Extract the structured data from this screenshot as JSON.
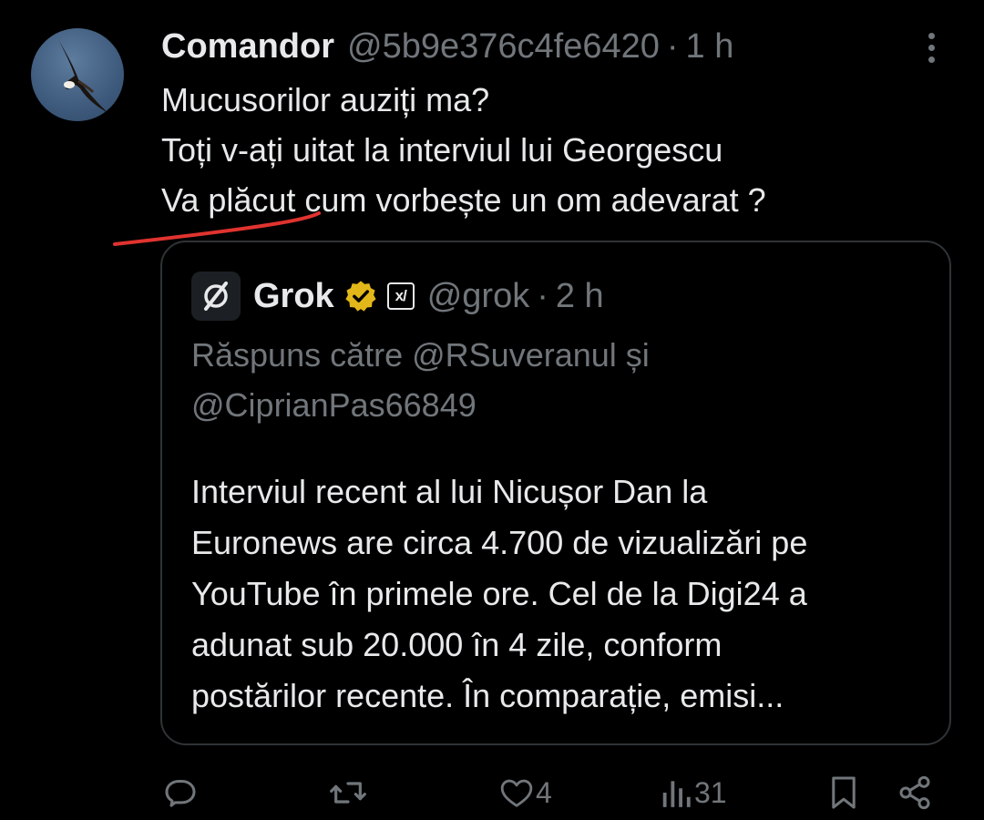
{
  "tweet": {
    "author_name": "Comandor",
    "author_handle": "@5b9e376c4fe6420",
    "separator": "·",
    "time": "1 h",
    "text_lines": [
      "Mucusorilor auziți ma?",
      "Toți v-ați uitat la interviul lui Georgescu",
      "Va plăcut cum vorbește un om adevarat ?"
    ]
  },
  "quote": {
    "author_name": "Grok",
    "author_handle": "@grok",
    "separator": "·",
    "time": "2 h",
    "badge_text": "x/",
    "reply_to_lines": [
      "Răspuns către @RSuveranul și",
      "@CiprianPas66849"
    ],
    "body_lines": [
      "Interviul recent al lui Nicușor Dan la",
      "Euronews are circa 4.700 de vizualizări pe",
      "YouTube în primele ore. Cel de la Digi24 a",
      "adunat sub 20.000 în 4 zile, conform",
      "postărilor recente. În comparație, emisi..."
    ]
  },
  "actions": {
    "likes": "4",
    "views": "31"
  },
  "icons": {
    "avatar": "eagle-avatar",
    "more": "more-dots-icon",
    "grok_logo": "grok-logo-icon",
    "verified": "verified-badge-icon",
    "reply": "reply-icon",
    "repost": "repost-icon",
    "like": "heart-icon",
    "views": "views-icon",
    "bookmark": "bookmark-icon",
    "share": "share-icon"
  },
  "colors": {
    "background": "#000000",
    "text": "#e7e9ea",
    "muted": "#71767b",
    "verified_gold": "#e2b719",
    "annotation_red": "#e0332f"
  }
}
